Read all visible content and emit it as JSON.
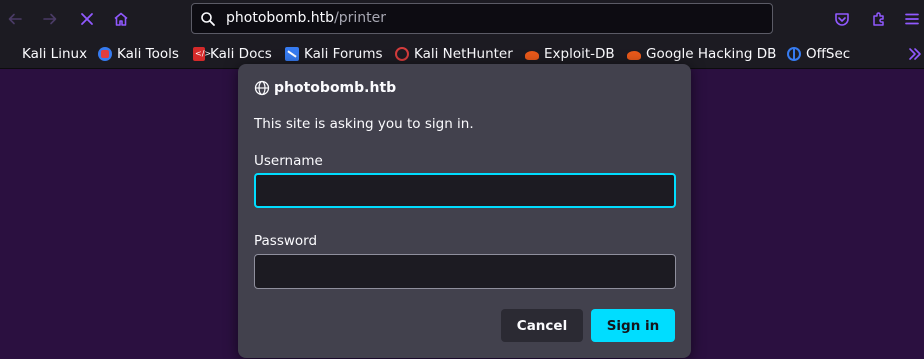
{
  "browser": {
    "url_host": "photobomb.htb",
    "url_path": "/printer",
    "accent_color": "#9059ff"
  },
  "bookmarks": [
    {
      "label": "Kali Linux",
      "icon": "kali-dragon-icon"
    },
    {
      "label": "Kali Tools",
      "icon": "kali-tools-icon"
    },
    {
      "label": "Kali Docs",
      "icon": "kali-docs-icon"
    },
    {
      "label": "Kali Forums",
      "icon": "kali-forums-icon"
    },
    {
      "label": "Kali NetHunter",
      "icon": "kali-nethunter-icon"
    },
    {
      "label": "Exploit-DB",
      "icon": "exploit-db-icon"
    },
    {
      "label": "Google Hacking DB",
      "icon": "exploit-db-icon"
    },
    {
      "label": "OffSec",
      "icon": "offsec-icon"
    }
  ],
  "dialog": {
    "host": "photobomb.htb",
    "message": "This site is asking you to sign in.",
    "username_label": "Username",
    "username_value": "",
    "password_label": "Password",
    "password_value": "",
    "cancel_label": "Cancel",
    "signin_label": "Sign in",
    "focus_color": "#00ddff"
  }
}
